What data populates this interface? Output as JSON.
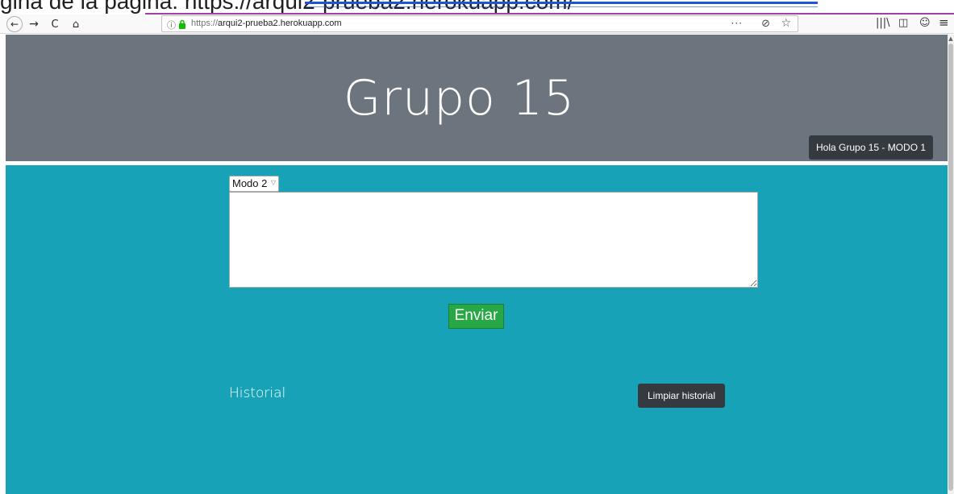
{
  "document_fragment": {
    "text": "gina de la página: https://arqui2-prueba2.herokuapp.com/"
  },
  "browser": {
    "nav": {
      "back_glyph": "←",
      "forward_glyph": "→",
      "reload_glyph": "C",
      "home_glyph": "⌂"
    },
    "url": {
      "scheme": "https://",
      "host": "arqui2-prueba2.herokuapp.com",
      "info_glyph": "ⓘ",
      "page_actions_glyph": "···",
      "pocket_glyph": "⊘",
      "bookmark_glyph": "☆"
    },
    "toolbar_icons": {
      "library": "|||\\",
      "sidebar": "◫",
      "account": "☺",
      "menu": "≡"
    }
  },
  "header": {
    "title": "Grupo 15",
    "mode_badge": "Hola Grupo 15 - MODO 1"
  },
  "form": {
    "mode_select": {
      "selected": "Modo 2",
      "options": [
        "Modo 2"
      ]
    },
    "message_value": "",
    "send_label": "Enviar"
  },
  "history": {
    "title": "Historial",
    "clear_label": "Limpiar historial"
  },
  "colors": {
    "header_bg": "#6c757d",
    "main_bg": "#17a2b8",
    "send_bg": "#28a745",
    "dark_button_bg": "#343a40"
  },
  "icons": {
    "back": "arrow-left-icon",
    "forward": "arrow-right-icon",
    "reload": "reload-icon",
    "home": "home-icon",
    "info": "info-icon",
    "lock": "lock-icon",
    "page_actions": "more-icon",
    "pocket": "pocket-icon",
    "bookmark": "star-icon",
    "library": "library-icon",
    "sidebar": "sidebar-icon",
    "account": "account-icon",
    "menu": "hamburger-menu-icon",
    "select_chevron": "chevron-down-icon"
  }
}
